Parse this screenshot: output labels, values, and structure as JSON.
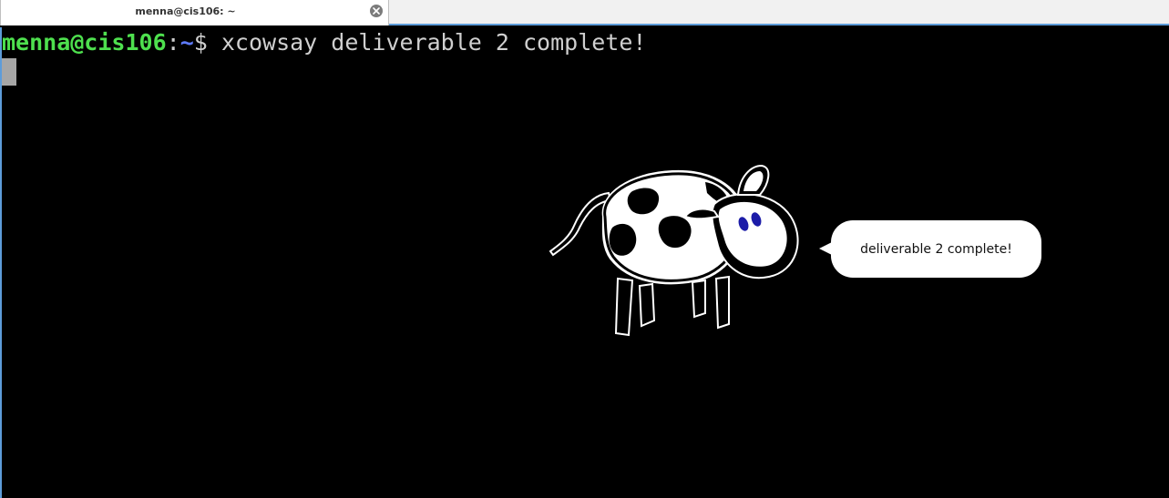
{
  "tab": {
    "title": "menna@cis106: ~"
  },
  "terminal": {
    "prompt_user": "menna@cis106",
    "prompt_colon": ":",
    "prompt_path": "~",
    "prompt_symbol": "$ ",
    "command": "xcowsay deliverable 2 complete!"
  },
  "xcowsay": {
    "bubble_text": "deliverable 2 complete!"
  },
  "colors": {
    "prompt_user": "#4ee04e",
    "prompt_path": "#5e7bff",
    "terminal_bg": "#000000",
    "terminal_fg": "#cfcfcf",
    "tab_accent": "#5d9cd9"
  },
  "icons": {
    "tab_close": "close-icon"
  }
}
